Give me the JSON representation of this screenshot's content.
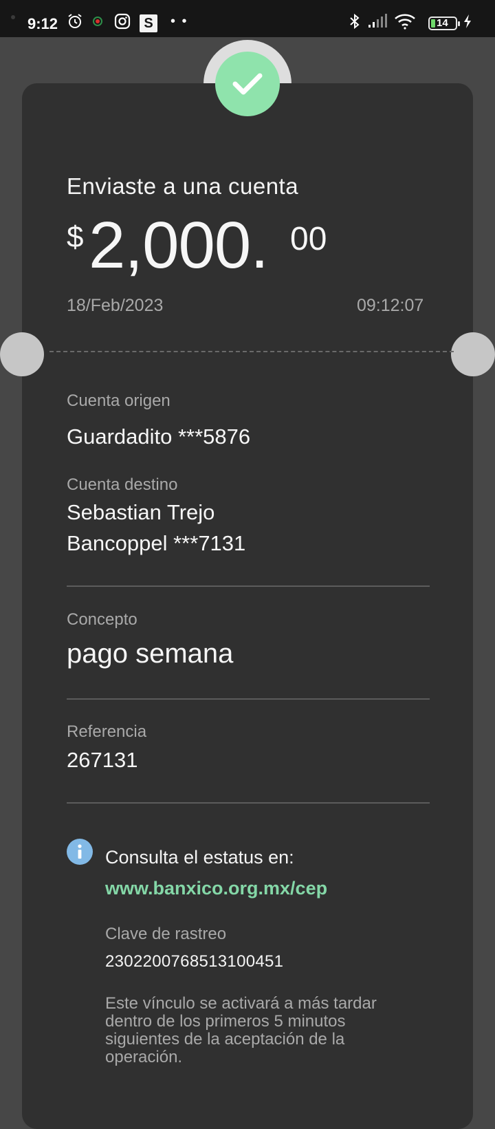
{
  "status_bar": {
    "time": "9:12",
    "s_badge": "S",
    "more": "• •",
    "battery": "14",
    "icons": [
      "alarm-icon",
      "location-icon",
      "instagram-icon",
      "s-app-icon",
      "bluetooth-icon",
      "signal-icon",
      "wifi-icon",
      "battery-icon",
      "charging-icon"
    ]
  },
  "receipt": {
    "headline": "Enviaste a una cuenta",
    "amount": {
      "currency": "$",
      "integer": "2,000.",
      "decimals": "00"
    },
    "date": "18/Feb/2023",
    "time": "09:12:07",
    "origin": {
      "label": "Cuenta origen",
      "value": "Guardadito ***5876"
    },
    "destination": {
      "label": "Cuenta destino",
      "name": "Sebastian Trejo",
      "account": "Bancoppel ***7131"
    },
    "concept": {
      "label": "Concepto",
      "value": "pago semana"
    },
    "reference": {
      "label": "Referencia",
      "value": "267131"
    },
    "status_info": {
      "text": "Consulta el estatus en:",
      "link": "www.banxico.org.mx/cep",
      "tracking_label": "Clave de rastreo",
      "tracking_value": "2302200768513100451",
      "note": "Este vínculo se activará a más tardar dentro de los primeros 5 minutos siguientes de la aceptación de la operación."
    }
  },
  "colors": {
    "background": "#474747",
    "card": "#303030",
    "success": "#8fe3ac",
    "link": "#84d7a7",
    "info": "#82b9e6"
  }
}
